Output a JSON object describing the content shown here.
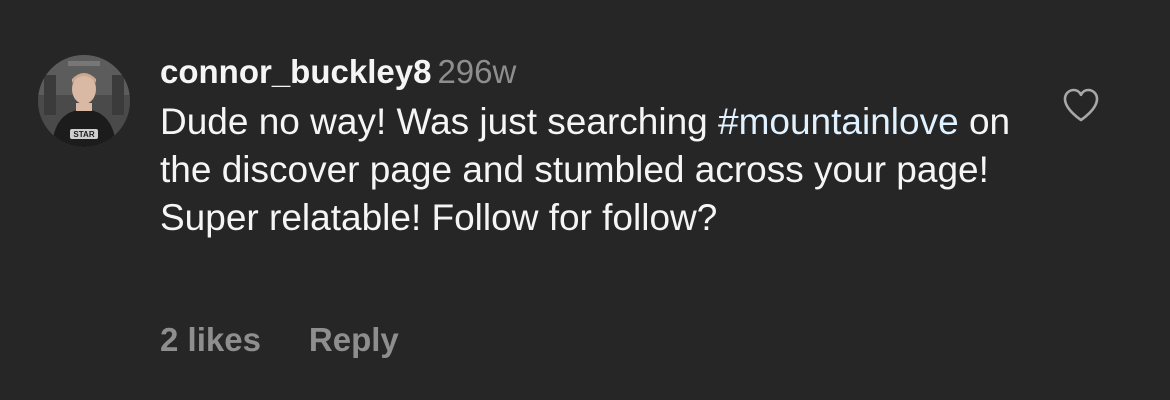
{
  "comment": {
    "username": "connor_buckley8",
    "timestamp": "296w",
    "text_before": "Dude no way! Was just searching ",
    "hashtag": "#mountainlove",
    "text_after": " on the discover page and stumbled across your page! Super relatable! Follow for follow?",
    "likes_label": "2 likes",
    "reply_label": "Reply",
    "avatar_badge_text": "STAR",
    "liked": false
  },
  "colors": {
    "background": "#262626",
    "primary_text": "#f5f5f5",
    "secondary_text": "#8e8e8e",
    "hashtag": "#e0f1ff"
  },
  "icons": {
    "like": "heart-outline-icon"
  }
}
